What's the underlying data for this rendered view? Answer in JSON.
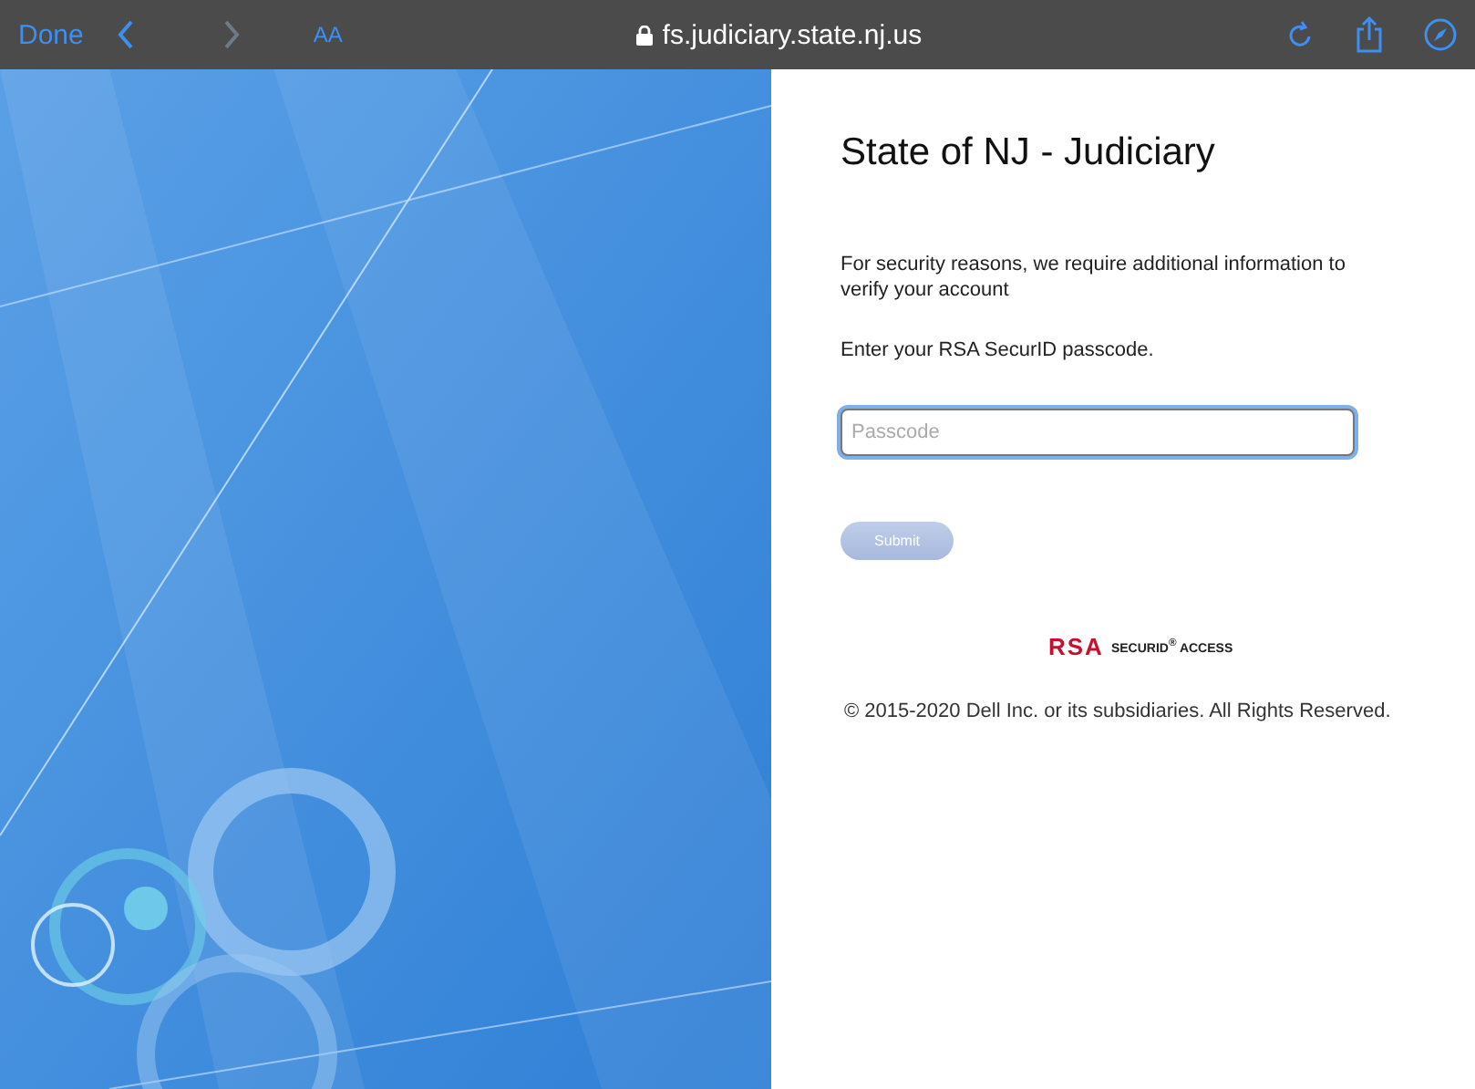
{
  "toolbar": {
    "done": "Done",
    "back": {
      "disabled": false
    },
    "forward": {
      "disabled": true
    },
    "text_size": "AA",
    "url": "fs.judiciary.state.nj.us"
  },
  "form": {
    "title": "State of NJ - Judiciary",
    "intro": "For security reasons, we require additional information to verify your account",
    "prompt": "Enter your RSA SecurID passcode.",
    "passcode": {
      "placeholder": "Passcode"
    },
    "submit": {
      "label": "Submit",
      "disabled": true
    }
  },
  "logo": {
    "mark": "RSA",
    "product": "SECURID$^{®}$ ACCESS"
  },
  "copyright": "© 2015-2020 Dell Inc. or its subsidiaries. All Rights Reserved."
}
